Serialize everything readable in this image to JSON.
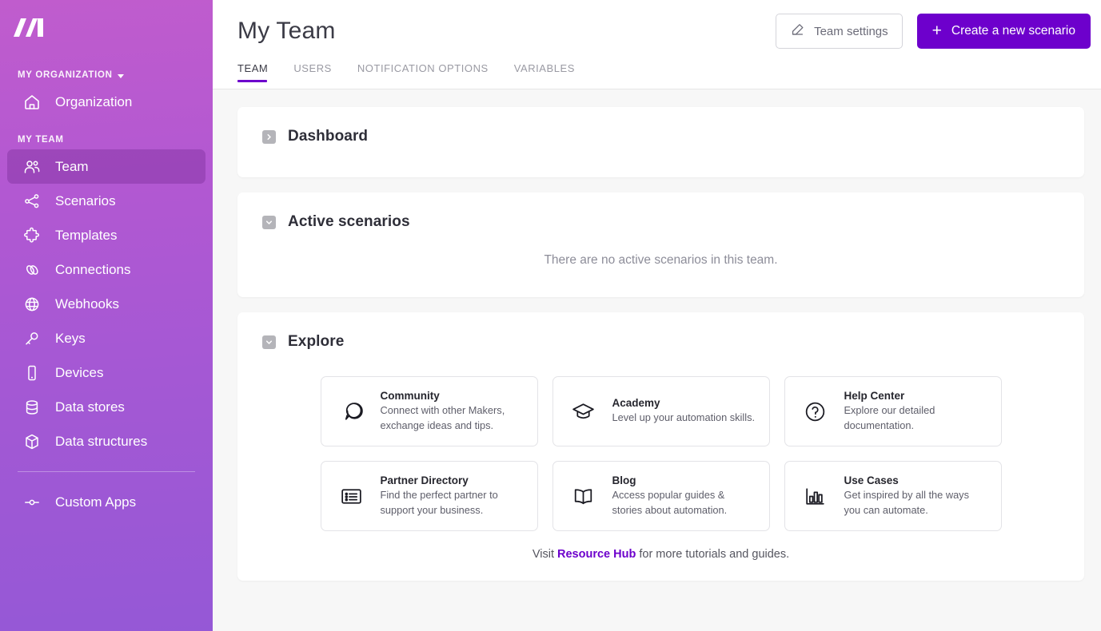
{
  "sidebar": {
    "logo_name": "make-logo",
    "org_section": {
      "label": "MY ORGANIZATION",
      "caret": "chevron-down-icon"
    },
    "org_items": [
      {
        "label": "Organization",
        "icon": "home-icon"
      }
    ],
    "team_section": {
      "label": "MY TEAM"
    },
    "team_items": [
      {
        "label": "Team",
        "icon": "users-icon",
        "active": true
      },
      {
        "label": "Scenarios",
        "icon": "share-nodes-icon",
        "active": false
      },
      {
        "label": "Templates",
        "icon": "puzzle-piece-icon",
        "active": false
      },
      {
        "label": "Connections",
        "icon": "link-icon",
        "active": false
      },
      {
        "label": "Webhooks",
        "icon": "globe-icon",
        "active": false
      },
      {
        "label": "Keys",
        "icon": "key-icon",
        "active": false
      },
      {
        "label": "Devices",
        "icon": "mobile-icon",
        "active": false
      },
      {
        "label": "Data stores",
        "icon": "database-icon",
        "active": false
      },
      {
        "label": "Data structures",
        "icon": "cube-icon",
        "active": false
      }
    ],
    "bottom_items": [
      {
        "label": "Custom Apps",
        "icon": "node-line-icon"
      }
    ]
  },
  "header": {
    "title": "My Team",
    "tabs": [
      {
        "label": "TEAM",
        "active": true
      },
      {
        "label": "USERS",
        "active": false
      },
      {
        "label": "NOTIFICATION OPTIONS",
        "active": false
      },
      {
        "label": "VARIABLES",
        "active": false
      }
    ],
    "team_settings_label": "Team settings",
    "team_settings_icon": "pencil-square-icon",
    "create_scenario_label": "Create a new scenario",
    "create_scenario_icon": "plus-icon"
  },
  "sections": {
    "dashboard": {
      "title": "Dashboard",
      "toggle_icon": "chevron-right-icon",
      "expanded": false
    },
    "active_scenarios": {
      "title": "Active scenarios",
      "toggle_icon": "chevron-down-icon",
      "expanded": true,
      "empty_message": "There are no active scenarios in this team."
    },
    "explore": {
      "title": "Explore",
      "toggle_icon": "chevron-down-icon",
      "expanded": true,
      "tiles": [
        {
          "title": "Community",
          "desc": "Connect with other Makers, exchange ideas and tips.",
          "icon": "chat-bubble-icon"
        },
        {
          "title": "Academy",
          "desc": "Level up your automation skills.",
          "icon": "graduation-cap-icon"
        },
        {
          "title": "Help Center",
          "desc": "Explore our detailed documentation.",
          "icon": "question-circle-icon"
        },
        {
          "title": "Partner Directory",
          "desc": "Find the perfect partner to support your business.",
          "icon": "list-icon"
        },
        {
          "title": "Blog",
          "desc": "Access popular guides & stories about automation.",
          "icon": "open-book-icon"
        },
        {
          "title": "Use Cases",
          "desc": "Get inspired by all the ways you can automate.",
          "icon": "bar-chart-icon"
        }
      ],
      "footer": {
        "prefix": "Visit ",
        "link": "Resource Hub",
        "suffix": " for more tutorials and guides."
      }
    }
  },
  "colors": {
    "brand_purple": "#6d00cc",
    "sidebar_top": "#c05ccd",
    "sidebar_bottom": "#9558d6",
    "highlight_red": "#ff0000",
    "content_bg": "#f7f7f7"
  }
}
